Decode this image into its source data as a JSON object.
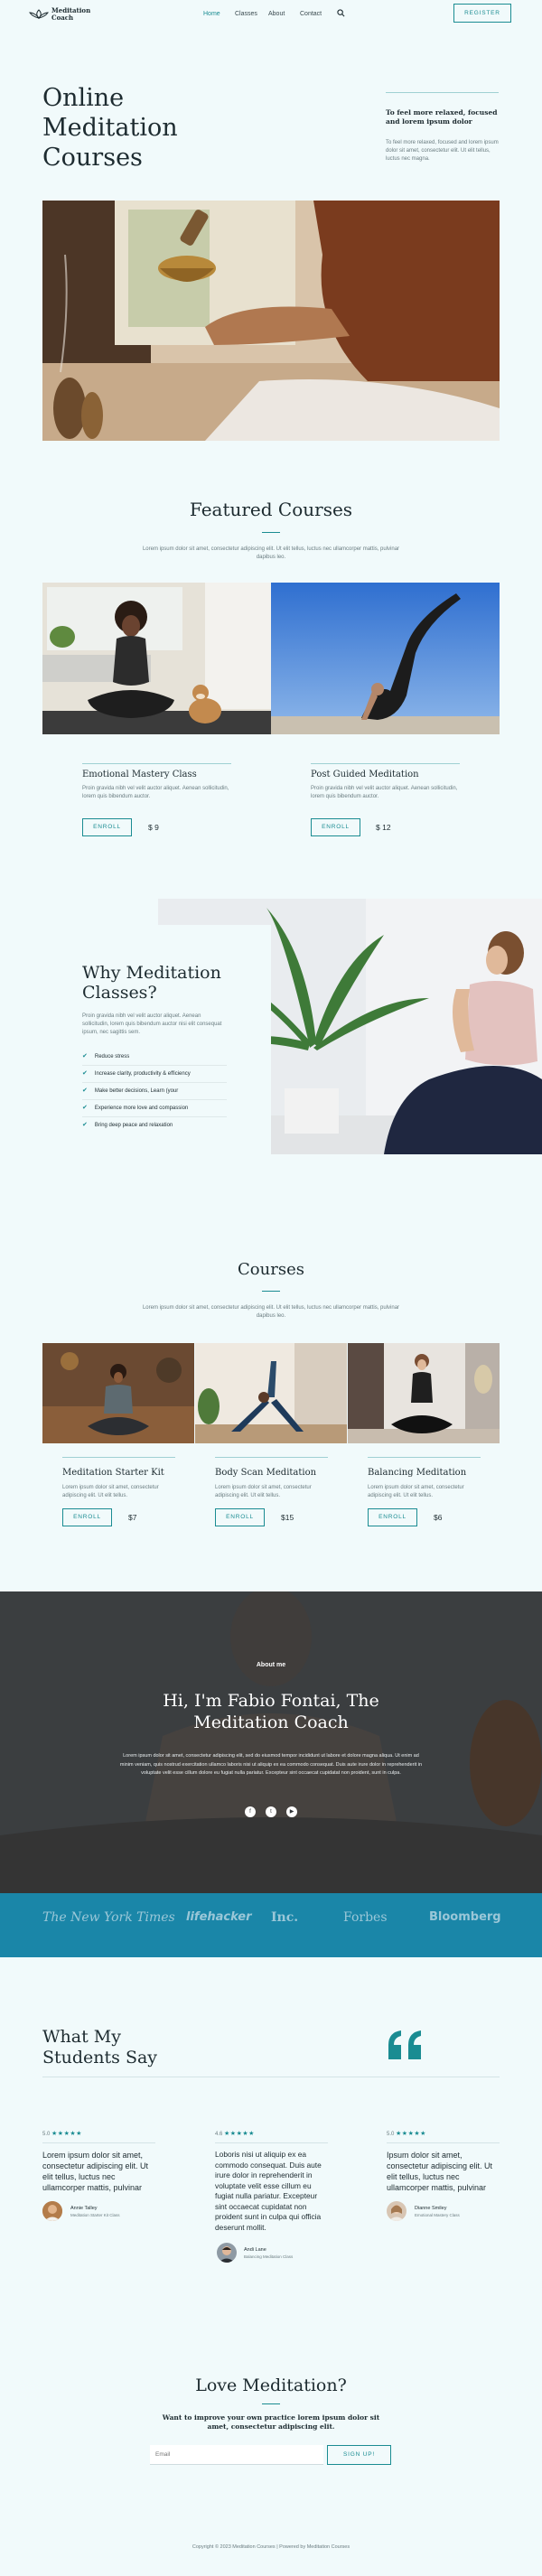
{
  "header": {
    "logo_line1": "Meditation",
    "logo_line2": "Coach",
    "nav": [
      "Home",
      "Classes",
      "About",
      "Contact"
    ],
    "register_label": "REGISTER"
  },
  "hero": {
    "title_lines": [
      "Online",
      "Meditation",
      "Courses"
    ],
    "aside_heading": "To feel more relaxed, focused and lorem ipsum dolor",
    "aside_text": "To feel more relaxed, focused and lorem ipsum dolor sit amet, consectetur elit. Ut elit tellus, luctus nec magna."
  },
  "featured": {
    "title": "Featured Courses",
    "intro": "Lorem ipsum dolor sit amet, consectetur adipiscing elit. Ut elit tellus, luctus nec ullamcorper mattis, pulvinar dapibus leo.",
    "cards": [
      {
        "title": "Emotional Mastery Class",
        "text": "Proin gravida nibh vel velit auctor aliquet. Aenean sollicitudin, lorem quis bibendum auctor.",
        "enroll": "ENROLL",
        "price": "$ 9"
      },
      {
        "title": "Post Guided Meditation",
        "text": "Proin gravida nibh vel velit auctor aliquet. Aenean sollicitudin, lorem quis bibendum auctor.",
        "enroll": "ENROLL",
        "price": "$ 12"
      }
    ]
  },
  "why": {
    "title_lines": [
      "Why Meditation",
      "Classes?"
    ],
    "text": "Proin gravida nibh vel velit auctor aliquet. Aenean sollicitudin, lorem quis bibendum auctor nisi elit consequat ipsum, nec sagittis sem.",
    "items": [
      "Reduce stress",
      "Increase clarity, productivity & efficiency",
      "Make better decisions, Learn (your",
      "Experience more love and compassion",
      "Bring deep peace and relaxation"
    ]
  },
  "courses": {
    "title": "Courses",
    "intro": "Lorem ipsum dolor sit amet, consectetur adipiscing elit. Ut elit tellus, luctus nec ullamcorper mattis, pulvinar dapibus leo.",
    "cards": [
      {
        "title": "Meditation Starter Kit",
        "text": "Lorem ipsum dolor sit amet, consectetur adipiscing elit. Ut elit tellus.",
        "enroll": "ENROLL",
        "price": "$7"
      },
      {
        "title": "Body Scan Meditation",
        "text": "Lorem ipsum dolor sit amet, consectetur adipiscing elit. Ut elit tellus.",
        "enroll": "ENROLL",
        "price": "$15"
      },
      {
        "title": "Balancing Meditation",
        "text": "Lorem ipsum dolor sit amet, consectetur adipiscing elit. Ut elit tellus.",
        "enroll": "ENROLL",
        "price": "$6"
      }
    ]
  },
  "about": {
    "eyebrow": "About me",
    "title_lines": [
      "Hi, I'm Fabio Fontai, The",
      "Meditation Coach"
    ],
    "text": "Lorem ipsum dolor sit amet, consectetur adipiscing elit, sed do eiusmod tempor incididunt ut labore et dolore magna aliqua. Ut enim ad minim veniam, quis nostrud exercitation ullamco laboris nisi ut aliquip ex ea commodo consequat. Duis aute irure dolor in reprehenderit in voluptate velit esse cillum dolore eu fugiat nulla pariatur. Excepteur sint occaecat cupidatat non proident, sunt in culpa."
  },
  "press": [
    "The New York Times",
    "lifehacker",
    "Inc.",
    "Forbes",
    "Bloomberg"
  ],
  "testimonials": {
    "title_lines": [
      "What My",
      "Students Say"
    ],
    "items": [
      {
        "score": "5.0",
        "text": "Lorem ipsum dolor sit amet, consectetur adipiscing elit. Ut elit tellus, luctus nec ullamcorper mattis, pulvinar",
        "name": "Annie Talley",
        "course": "Meditation Starter Kit Class"
      },
      {
        "score": "4.6",
        "text": "Loboris nisi ut aliquip ex ea commodo consequat. Duis aute irure dolor in reprehenderit in voluptate velit esse cillum eu fugiat nulla pariatur. Excepteur sint occaecat cupidatat non proident sunt in culpa qui officia deserunt mollit.",
        "name": "Andi Lane",
        "course": "Balancing Meditation Class"
      },
      {
        "score": "5.0",
        "text": "Ipsum dolor sit amet, consectetur adipiscing elit. Ut elit tellus, luctus nec ullamcorper mattis, pulvinar",
        "name": "Dianne Smiley",
        "course": "Emotional Mastery Class"
      }
    ]
  },
  "newsletter": {
    "title": "Love Meditation?",
    "subtitle": "Want to improve your own practice lorem ipsum dolor sit amet, consectetur adipiscing elit.",
    "placeholder": "Email",
    "button": "SIGN UP!"
  },
  "footer": {
    "text": "Copyright © 2023 Meditation Courses | Powered by Meditation Courses"
  },
  "colors": {
    "accent": "#1a8c92",
    "background": "#f1fafb",
    "press_band": "#1a86a8",
    "about_overlay": "#3a4044"
  }
}
